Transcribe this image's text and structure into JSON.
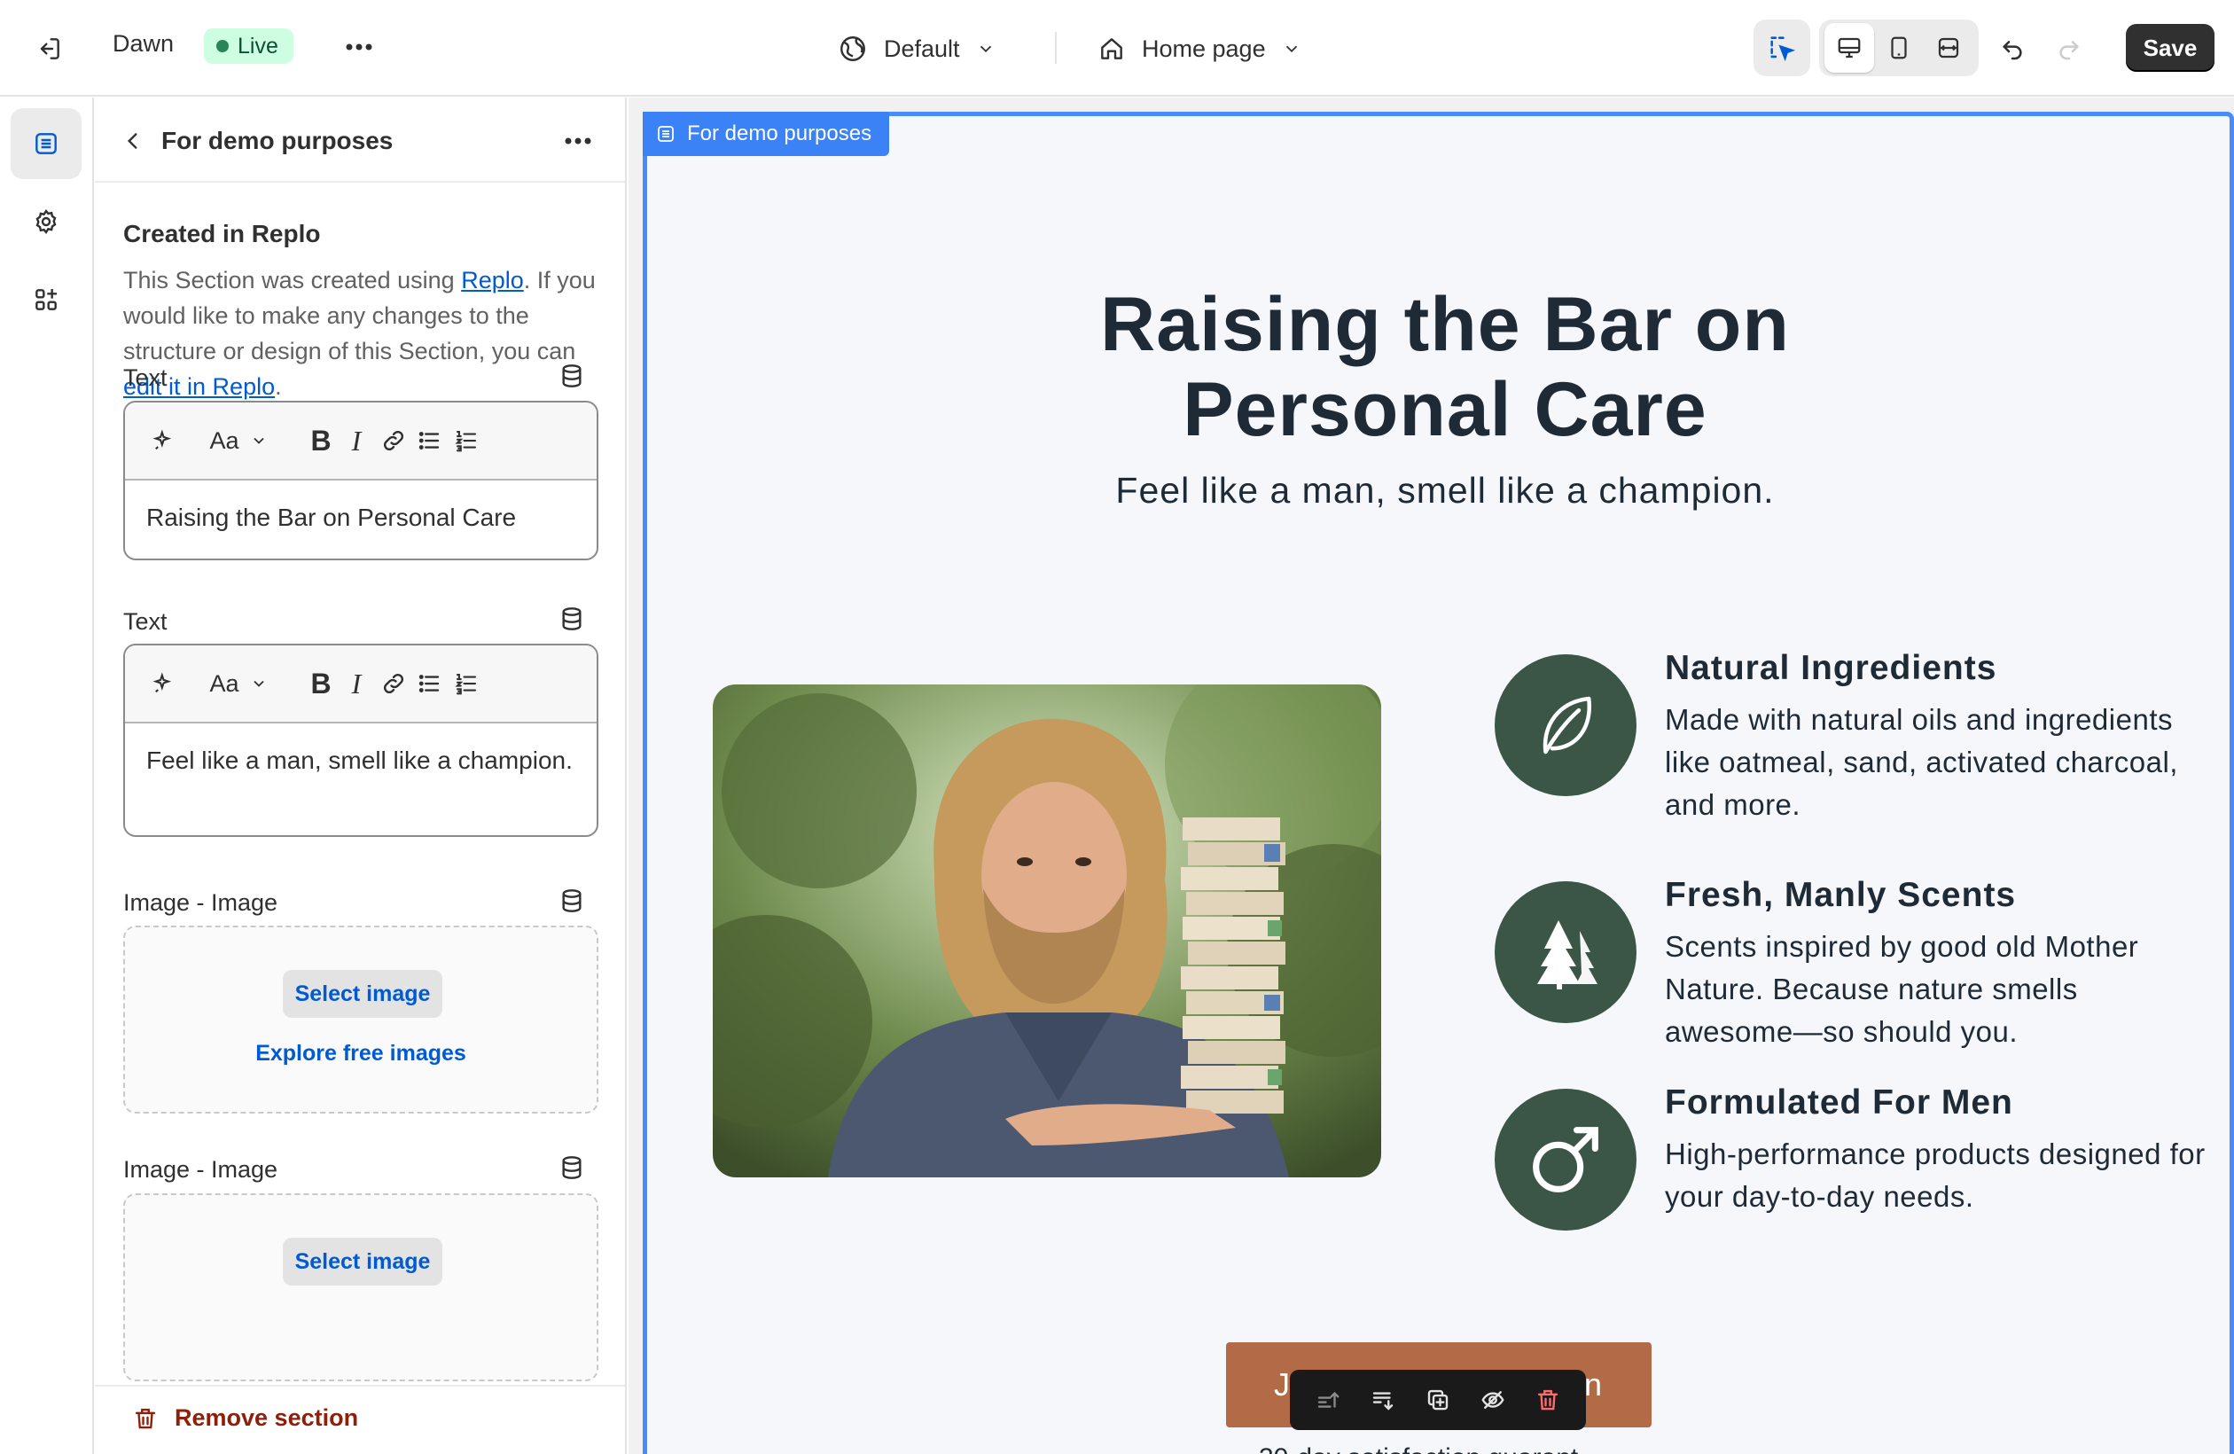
{
  "topbar": {
    "theme_name": "Dawn",
    "status": "Live",
    "context_select": "Default",
    "page_select": "Home page",
    "save_label": "Save"
  },
  "panel": {
    "title": "For demo purposes",
    "heading": "Created in Replo",
    "desc_part1": "This Section was created using ",
    "desc_link1": "Replo",
    "desc_part2": ". If you would like to make any changes to the structure or design of this Section, you can ",
    "desc_link2": "edit it in Replo",
    "desc_part3": ".",
    "fields": [
      {
        "label": "Text",
        "value": "Raising the Bar on Personal Care"
      },
      {
        "label": "Text",
        "value": "Feel like a man, smell like a champion."
      },
      {
        "label": "Image - Image",
        "select_label": "Select image",
        "explore_label": "Explore free images"
      },
      {
        "label": "Image - Image",
        "select_label": "Select image"
      }
    ],
    "remove_label": "Remove section"
  },
  "preview": {
    "section_tag": "For demo purposes",
    "title": "Raising the Bar on Personal Care",
    "subtitle": "Feel like a man, smell like a champion.",
    "features": [
      {
        "title": "Natural Ingredients",
        "desc": "Made with natural oils and ingredients like oatmeal, sand, activated charcoal, and more.",
        "icon": "leaf-icon"
      },
      {
        "title": "Fresh, Manly Scents",
        "desc": "Scents inspired by good old Mother Nature. Because nature smells awesome—so should you.",
        "icon": "trees-icon"
      },
      {
        "title": "Formulated For Men",
        "desc": "High-performance products designed for your day-to-day needs.",
        "icon": "male-symbol-icon"
      }
    ],
    "cta_head": "J",
    "cta_tail": "n",
    "cta_under": "30-day satisfaction guarant"
  },
  "colors": {
    "accent_blue": "#4a8cf7",
    "feature_green": "#3b5646",
    "cta_brown": "#b36a46",
    "live_bg": "#cdfee1"
  }
}
